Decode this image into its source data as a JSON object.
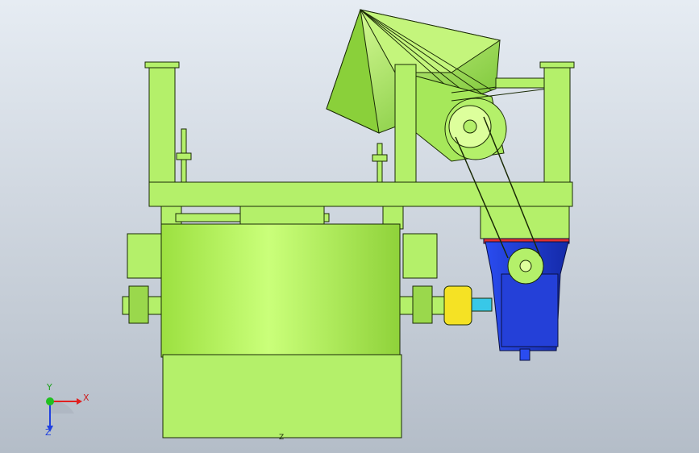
{
  "viewport": {
    "background_top": "#e6ecf3",
    "background_bottom": "#b4bdc8",
    "part_color": "#b4f06a",
    "part_dark": "#7fc23a",
    "part_edge": "#1a2a05",
    "gearbox_color": "#1f3ee0",
    "coupling_color": "#f5e224",
    "shaft_color": "#38c8e8",
    "flange_color": "#e03030"
  },
  "triad": {
    "x_label": "X",
    "y_label": "Y",
    "z_label": "Z",
    "x_color": "#e02020",
    "y_color": "#20c020",
    "z_color": "#2040e0"
  },
  "part_mark": "Z"
}
